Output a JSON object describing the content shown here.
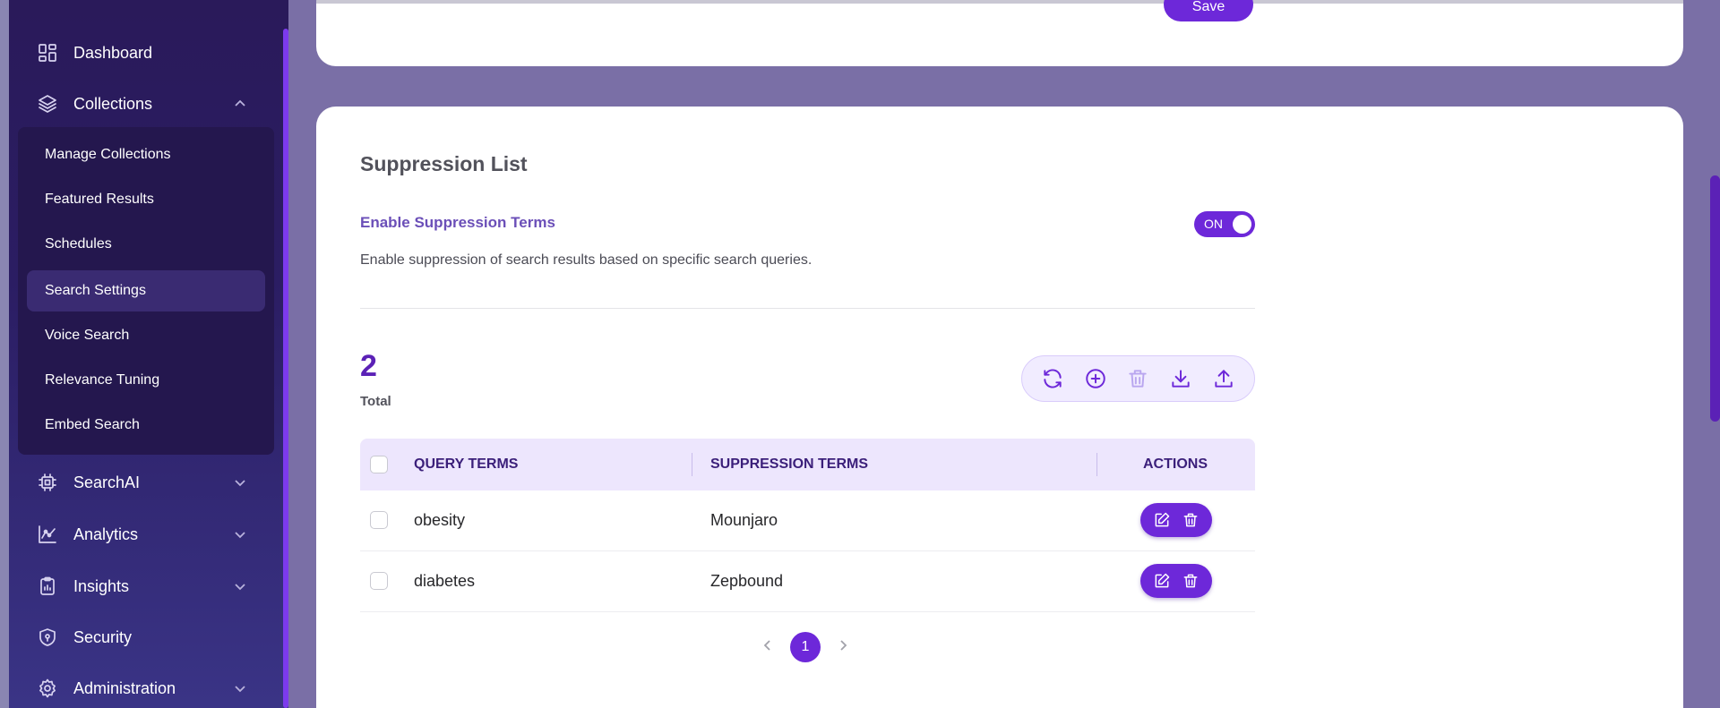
{
  "sidebar": {
    "items": [
      {
        "label": "Dashboard",
        "icon": "dashboard-icon"
      },
      {
        "label": "Collections",
        "icon": "layers-icon",
        "expanded": true
      },
      {
        "label": "SearchAI",
        "icon": "chip-icon"
      },
      {
        "label": "Analytics",
        "icon": "chart-line-icon"
      },
      {
        "label": "Insights",
        "icon": "clipboard-icon"
      },
      {
        "label": "Security",
        "icon": "shield-icon"
      },
      {
        "label": "Administration",
        "icon": "gear-icon"
      }
    ],
    "submenu": [
      {
        "label": "Manage Collections"
      },
      {
        "label": "Featured Results"
      },
      {
        "label": "Schedules"
      },
      {
        "label": "Search Settings",
        "active": true
      },
      {
        "label": "Voice Search"
      },
      {
        "label": "Relevance Tuning"
      },
      {
        "label": "Embed Search"
      }
    ]
  },
  "top_card": {
    "save_label": "Save"
  },
  "suppression": {
    "title": "Suppression List",
    "enable_label": "Enable Suppression Terms",
    "toggle_label": "ON",
    "description": "Enable suppression of search results based on specific search queries.",
    "total_count": "2",
    "total_label": "Total",
    "columns": [
      "QUERY TERMS",
      "SUPPRESSION TERMS",
      "ACTIONS"
    ],
    "rows": [
      {
        "query": "obesity",
        "suppression": "Mounjaro"
      },
      {
        "query": "diabetes",
        "suppression": "Zepbound"
      }
    ],
    "page": "1"
  },
  "colors": {
    "accent": "#6d28d9",
    "sidebar": "#2b1d63",
    "header_bg": "#ede6fd"
  }
}
